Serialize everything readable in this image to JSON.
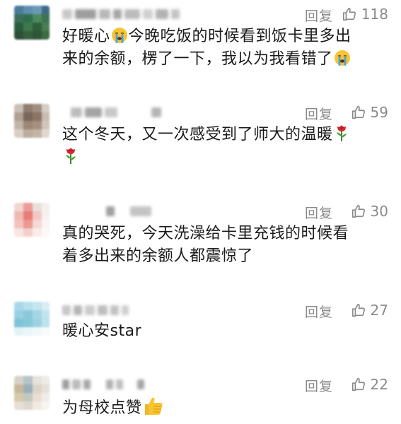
{
  "comments": [
    {
      "reply_label": "回复",
      "like_count": "118",
      "line1_a": "好暖心",
      "line1_b": "今晚吃饭的时候看到饭卡里多出",
      "line2_a": "来的余额，楞了一下，我以为我看错了"
    },
    {
      "reply_label": "回复",
      "like_count": "59",
      "line1_a": "这个冬天，又一次感受到了师大的温暖"
    },
    {
      "reply_label": "回复",
      "like_count": "30",
      "line1_a": "真的哭死，今天洗澡给卡里充钱的时候看",
      "line2_a": "着多出来的余额人都震惊了"
    },
    {
      "reply_label": "回复",
      "like_count": "27",
      "line1_a": "暖心安star"
    },
    {
      "reply_label": "回复",
      "like_count": "22",
      "line1_a": "为母校点赞"
    }
  ],
  "icons": {
    "like": "thumbs-up-icon",
    "crying": "crying-face-icon",
    "rose": "rose-icon",
    "thumbs_emoji": "thumbs-up-emoji-icon"
  },
  "colors": {
    "meta_gray": "#8a8a8a",
    "text": "#1a1a1a",
    "emoji_yellow": "#f7c531",
    "rose_red": "#d7262e"
  }
}
